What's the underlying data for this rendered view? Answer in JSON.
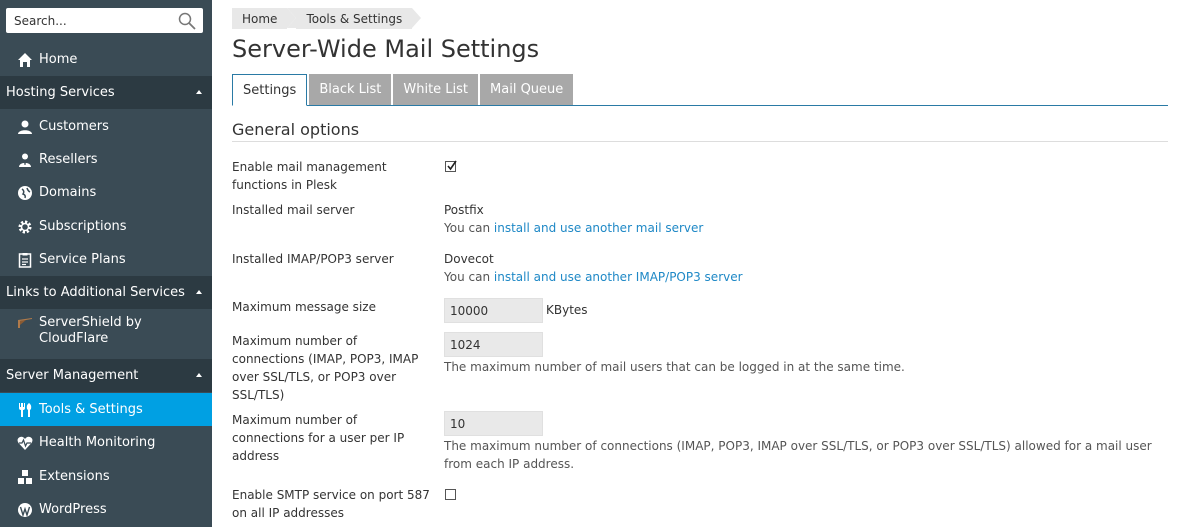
{
  "search": {
    "placeholder": "Search..."
  },
  "sidebar": {
    "home": "Home",
    "hosting_services": "Hosting Services",
    "customers": "Customers",
    "resellers": "Resellers",
    "domains": "Domains",
    "subscriptions": "Subscriptions",
    "service_plans": "Service Plans",
    "links_additional": "Links to Additional Services",
    "servershield_line1": "ServerShield by",
    "servershield_line2": "CloudFlare",
    "server_management": "Server Management",
    "tools_settings": "Tools & Settings",
    "health_monitoring": "Health Monitoring",
    "extensions": "Extensions",
    "wordpress": "WordPress"
  },
  "breadcrumb": [
    "Home",
    "Tools & Settings"
  ],
  "page_title": "Server-Wide Mail Settings",
  "tabs": [
    "Settings",
    "Black List",
    "White List",
    "Mail Queue"
  ],
  "section_title": "General options",
  "form": {
    "enable_mgmt_label_1": "Enable mail management",
    "enable_mgmt_label_2": "functions in Plesk",
    "enable_mgmt_checked": true,
    "mail_server_label": "Installed mail server",
    "mail_server_value": "Postfix",
    "you_can": "You can",
    "mail_server_link": "install and use another mail server",
    "imap_label": "Installed IMAP/POP3 server",
    "imap_value": "Dovecot",
    "imap_link": "install and use another IMAP/POP3 server",
    "max_size_label": "Maximum message size",
    "max_size_value": "10000",
    "max_size_unit": "KBytes",
    "max_conn_label": [
      "Maximum number of",
      "connections (IMAP, POP3, IMAP",
      "over SSL/TLS, or POP3 over",
      "SSL/TLS)"
    ],
    "max_conn_value": "1024",
    "max_conn_hint": "The maximum number of mail users that can be logged in at the same time.",
    "max_conn_ip_label": [
      "Maximum number of",
      "connections for a user per IP",
      "address"
    ],
    "max_conn_ip_value": "10",
    "max_conn_ip_hint_1": "The maximum number of connections (IMAP, POP3, IMAP over SSL/TLS, or POP3 over SSL/TLS) allowed for a mail user",
    "max_conn_ip_hint_2": "from each IP address.",
    "smtp_label_1": "Enable SMTP service on port 587",
    "smtp_label_2": "on all IP addresses",
    "smtp_checked": false
  }
}
